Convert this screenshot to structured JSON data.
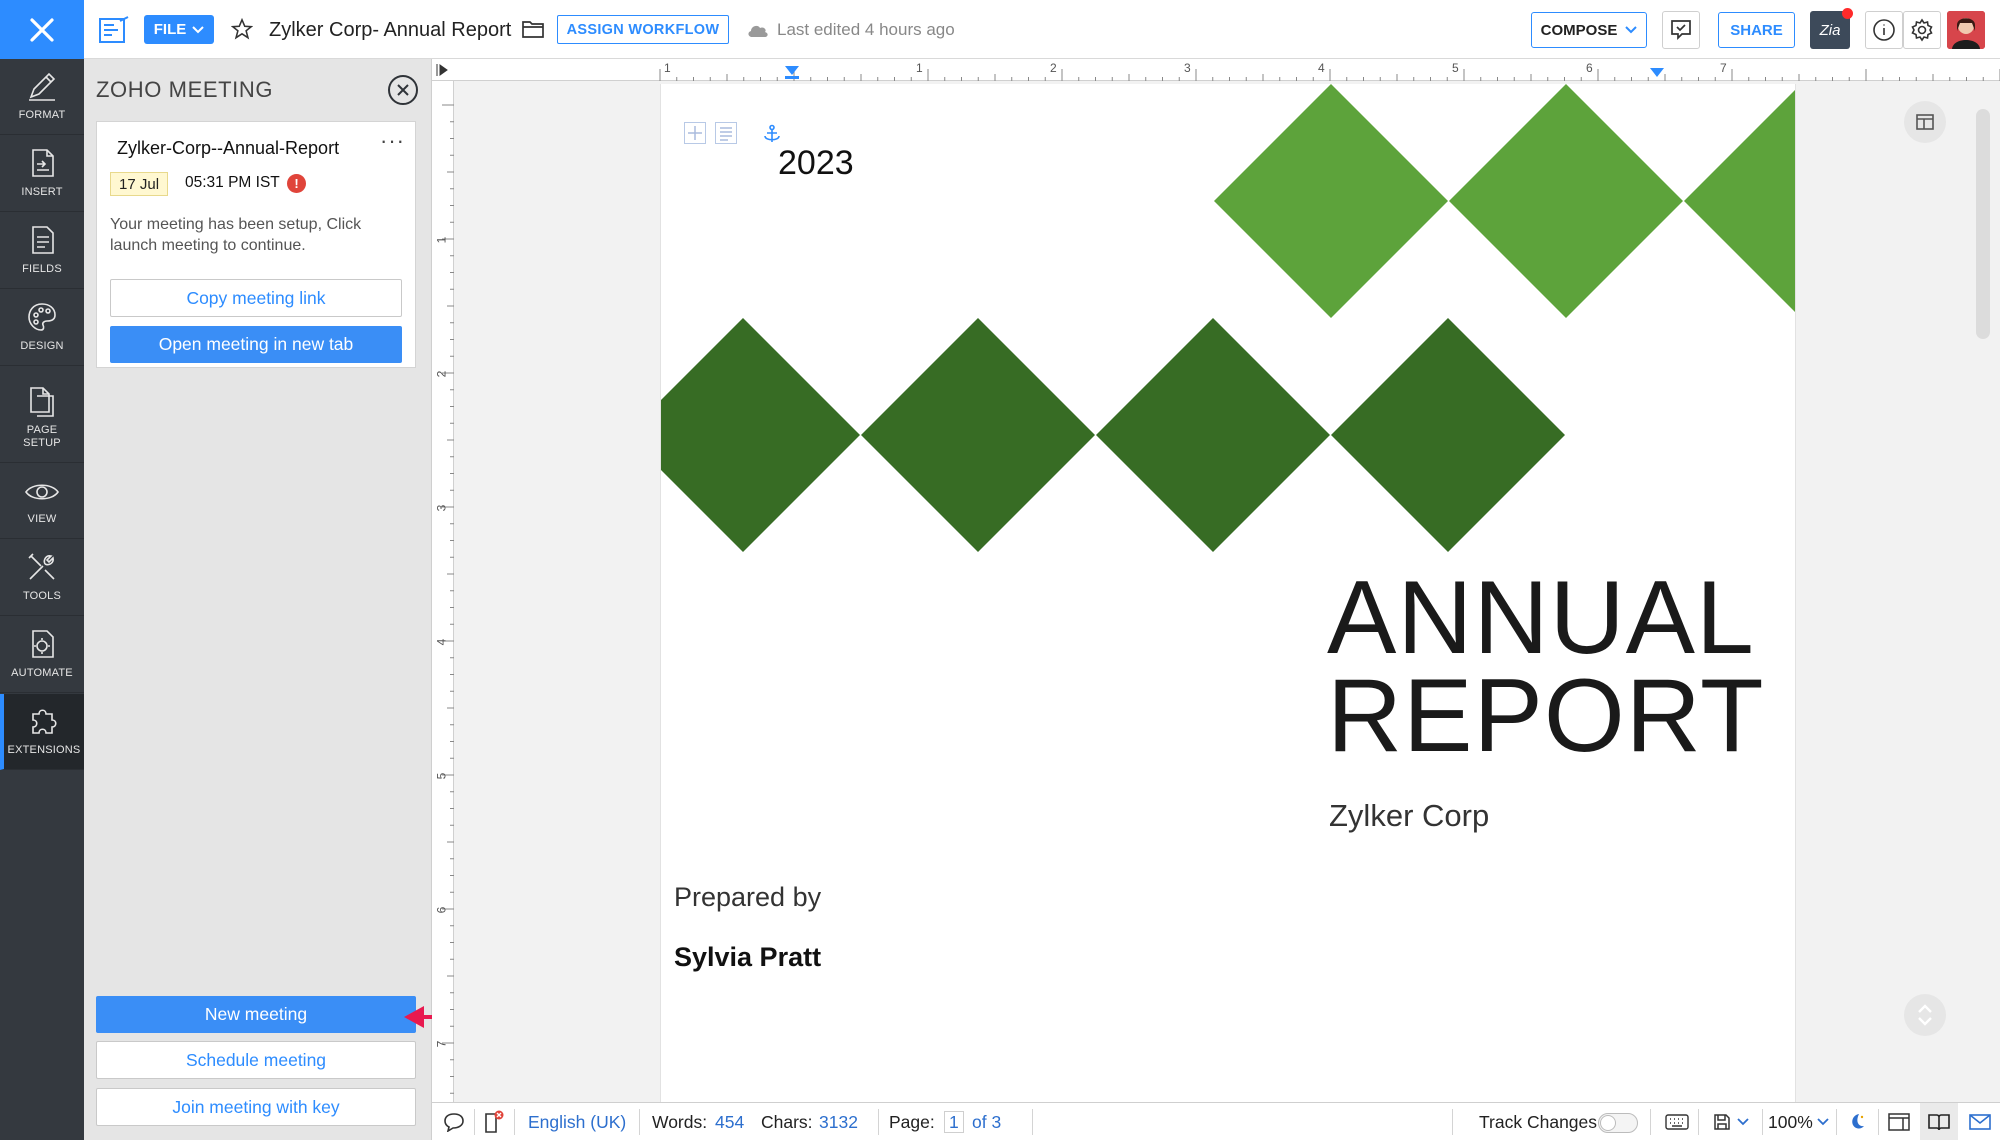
{
  "topbar": {
    "file_label": "FILE",
    "doc_title": "Zylker Corp- Annual Report",
    "assign_workflow_label": "ASSIGN WORKFLOW",
    "last_edited": "Last edited 4 hours ago",
    "compose_label": "COMPOSE",
    "share_label": "SHARE",
    "zia_label": "Zia"
  },
  "rail": {
    "items": [
      {
        "label": "FORMAT",
        "icon": "pen-icon"
      },
      {
        "label": "INSERT",
        "icon": "insert-icon"
      },
      {
        "label": "FIELDS",
        "icon": "fields-icon"
      },
      {
        "label": "DESIGN",
        "icon": "palette-icon"
      },
      {
        "label": "PAGE SETUP",
        "icon": "page-setup-icon"
      },
      {
        "label": "VIEW",
        "icon": "eye-icon"
      },
      {
        "label": "TOOLS",
        "icon": "tools-icon"
      },
      {
        "label": "AUTOMATE",
        "icon": "automate-icon"
      },
      {
        "label": "EXTENSIONS",
        "icon": "puzzle-icon"
      }
    ],
    "active": "EXTENSIONS"
  },
  "panel": {
    "title": "ZOHO MEETING",
    "meeting": {
      "name": "Zylker-Corp--Annual-Report",
      "date": "17 Jul",
      "time": "05:31 PM IST",
      "alert": "!",
      "message": "Your meeting has been setup, Click launch meeting to continue.",
      "copy_link_label": "Copy meeting link",
      "open_label": "Open meeting in new tab"
    },
    "new_meeting_label": "New meeting",
    "schedule_label": "Schedule meeting",
    "join_label": "Join meeting with key"
  },
  "ruler": {
    "top_numbers": [
      "1",
      "1",
      "2",
      "3",
      "4",
      "5",
      "6",
      "7"
    ],
    "left_numbers": [
      "1",
      "2",
      "3",
      "4",
      "5",
      "6",
      "7"
    ]
  },
  "document": {
    "year": "2023",
    "title_line1": "ANNUAL",
    "title_line2": "REPORT",
    "company": "Zylker Corp",
    "prepared_by_label": "Prepared by",
    "author": "Sylvia Pratt",
    "colors": {
      "light_green": "#5da33b",
      "dark_green": "#376c24"
    }
  },
  "status": {
    "language": "English (UK)",
    "words_label": "Words:",
    "words_value": "454",
    "chars_label": "Chars:",
    "chars_value": "3132",
    "page_label": "Page:",
    "page_current": "1",
    "page_total": "of 3",
    "track_changes_label": "Track Changes",
    "zoom": "100%"
  },
  "colors": {
    "accent": "#2d8cff",
    "rail": "#34393f",
    "alert": "#e0443a"
  }
}
